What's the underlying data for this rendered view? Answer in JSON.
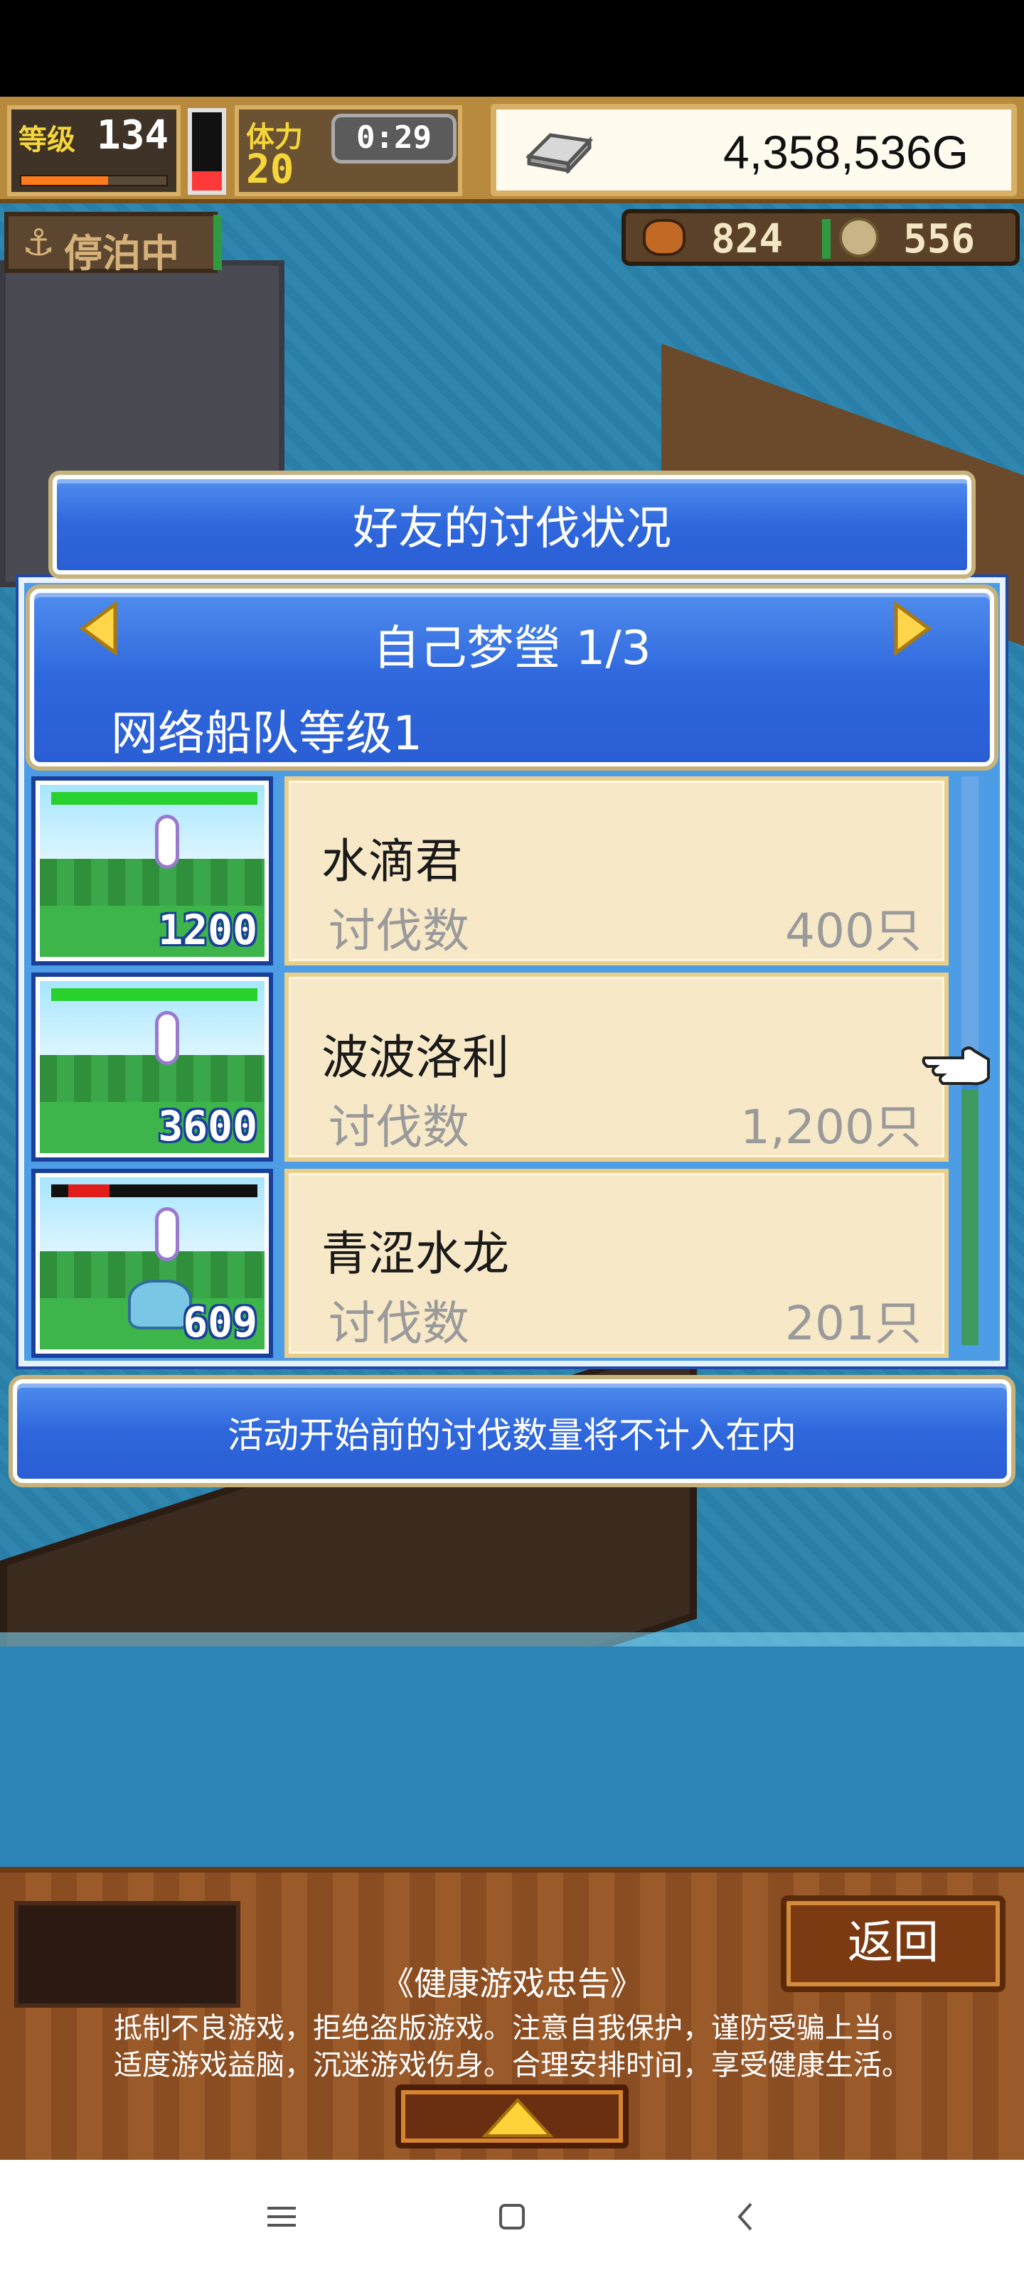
{
  "hud": {
    "level_label": "等级",
    "level_value": "134",
    "exp_fraction": 0.6,
    "stamina_fraction": 0.25,
    "stamina_label": "体力",
    "stamina_value": "20",
    "timer": "0:29",
    "gold": "4,358,536G",
    "dock_status": "停泊中",
    "resource1_value": "824",
    "resource2_value": "556"
  },
  "dialog": {
    "title": "好友的讨伐状况",
    "friend_name": "自己梦瑩 1/3",
    "fleet_level": "网络船队等级1",
    "rows": [
      {
        "monster": "水滴君",
        "label": "讨伐数",
        "count": "400只",
        "reward": "1200",
        "hp_fraction": 1.0,
        "hp_low": false
      },
      {
        "monster": "波波洛利",
        "label": "讨伐数",
        "count": "1,200只",
        "reward": "3600",
        "hp_fraction": 1.0,
        "hp_low": false
      },
      {
        "monster": "青涩水龙",
        "label": "讨伐数",
        "count": "201只",
        "reward": "609",
        "hp_fraction": 0.2,
        "hp_low": true
      }
    ],
    "footer_note": "活动开始前的讨伐数量将不计入在内"
  },
  "bottom": {
    "back_label": "返回",
    "notice_title": "《健康游戏忠告》",
    "notice_line1": "抵制不良游戏，拒绝盗版游戏。注意自我保护，谨防受骗上当。",
    "notice_line2": "适度游戏益脑，沉迷游戏伤身。合理安排时间，享受健康生活。"
  },
  "colors": {
    "panel_blue": "#2f67dc",
    "card_bg": "#f7e8c8",
    "hp_green": "#29d12e",
    "hp_red": "#e21b1b"
  }
}
